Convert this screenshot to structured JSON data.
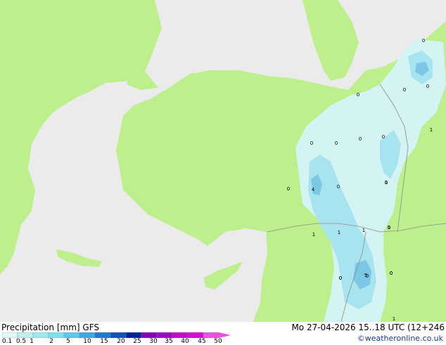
{
  "map": {
    "contour_labels": [
      "0",
      "0",
      "0",
      "0",
      "0",
      "0",
      "0",
      "0",
      "0",
      "0",
      "0",
      "0",
      "1",
      "1",
      "1",
      "1",
      "4",
      "0",
      "0",
      "1",
      "1",
      "0",
      "5",
      "0",
      "0",
      "1"
    ]
  },
  "footer": {
    "title": "Precipitation [mm]",
    "model": "GFS",
    "valid_time": "Mo 27-04-2026 15..18 UTC (12+246",
    "credit": "©weatheronline.co.uk"
  },
  "legend": {
    "labels": [
      "0.1",
      "0.5",
      "1",
      "2",
      "5",
      "10",
      "15",
      "20",
      "25",
      "30",
      "35",
      "40",
      "45",
      "50"
    ],
    "colors": [
      "#e0f8f8",
      "#c0f0f0",
      "#a0e8f0",
      "#80e0f0",
      "#60c8e8",
      "#40a8e0",
      "#2078d0",
      "#1050c0",
      "#0020a0",
      "#8000c0",
      "#a000c8",
      "#c800d0",
      "#e000d8",
      "#f050e0"
    ]
  },
  "colors": {
    "sea": "#ebebeb",
    "land": "#bdf08c",
    "precip_light": "#d4f4f4",
    "precip_mid": "#a8e4ef",
    "precip_heavy": "#7cc8e4",
    "border": "#8c8c8c"
  }
}
